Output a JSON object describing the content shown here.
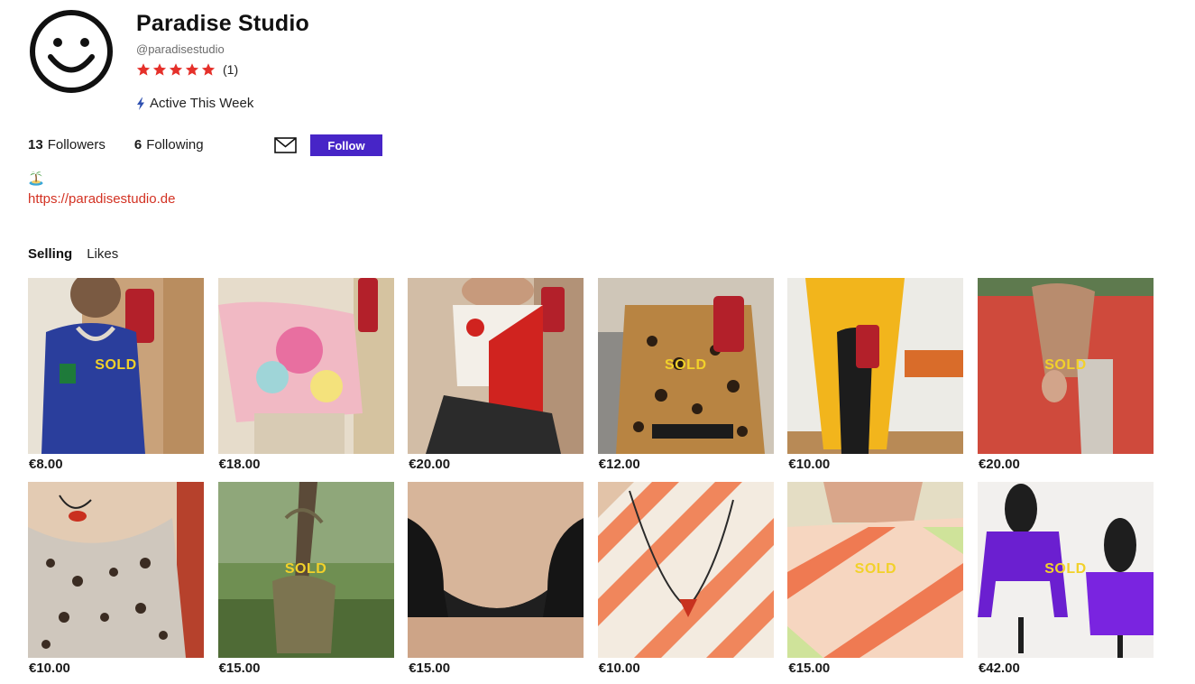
{
  "profile": {
    "name": "Paradise Studio",
    "handle": "@paradisestudio",
    "rating_stars": 5,
    "rating_count": "(1)",
    "activity": "Active This Week",
    "followers_count": "13",
    "followers_label": "Followers",
    "following_count": "6",
    "following_label": "Following",
    "follow_label": "Follow",
    "bio_emoji": "desert-island-emoji",
    "website": "https://paradisestudio.de"
  },
  "tabs": [
    {
      "label": "Selling",
      "active": true
    },
    {
      "label": "Likes",
      "active": false
    }
  ],
  "colors": {
    "accent": "#4725c7",
    "link": "#d33223",
    "star": "#e5302a",
    "sold_text": "#f2d12a"
  },
  "sold_label": "SOLD",
  "listings": [
    {
      "price": "€8.00",
      "sold": true,
      "desc": "blue Italia tank top"
    },
    {
      "price": "€18.00",
      "sold": false,
      "desc": "pastel floral t-shirt"
    },
    {
      "price": "€20.00",
      "sold": false,
      "desc": "red and white floral top"
    },
    {
      "price": "€12.00",
      "sold": true,
      "desc": "leopard print blouse"
    },
    {
      "price": "€10.00",
      "sold": false,
      "desc": "yellow scarf"
    },
    {
      "price": "€20.00",
      "sold": true,
      "desc": "red jacket"
    },
    {
      "price": "€10.00",
      "sold": false,
      "desc": "leopard print tank"
    },
    {
      "price": "€15.00",
      "sold": true,
      "desc": "khaki canvas bag"
    },
    {
      "price": "€15.00",
      "sold": false,
      "desc": "black crop top"
    },
    {
      "price": "€10.00",
      "sold": false,
      "desc": "orange tie-dye shirt"
    },
    {
      "price": "€15.00",
      "sold": true,
      "desc": "tie-dye t-shirt"
    },
    {
      "price": "€42.00",
      "sold": true,
      "desc": "purple sweater"
    }
  ]
}
